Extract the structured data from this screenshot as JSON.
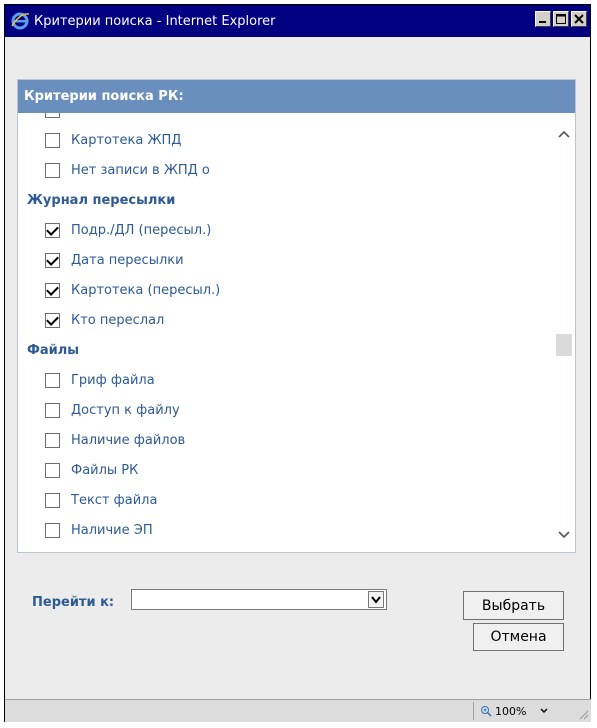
{
  "window": {
    "title": "Критерии поиска - Internet Explorer"
  },
  "panel": {
    "header": "Критерии поиска РК:",
    "items": [
      {
        "type": "checkbox",
        "label": "Картотека ЖПД",
        "checked": false
      },
      {
        "type": "checkbox",
        "label": "Нет записи в ЖПД о",
        "checked": false
      },
      {
        "type": "group",
        "label": "Журнал пересылки"
      },
      {
        "type": "checkbox",
        "label": "Подр./ДЛ (пересыл.)",
        "checked": true
      },
      {
        "type": "checkbox",
        "label": "Дата пересылки",
        "checked": true
      },
      {
        "type": "checkbox",
        "label": "Картотека (пересыл.)",
        "checked": true
      },
      {
        "type": "checkbox",
        "label": "Кто переслал",
        "checked": true
      },
      {
        "type": "group",
        "label": "Файлы"
      },
      {
        "type": "checkbox",
        "label": "Гриф файла",
        "checked": false
      },
      {
        "type": "checkbox",
        "label": "Доступ к файлу",
        "checked": false
      },
      {
        "type": "checkbox",
        "label": "Наличие файлов",
        "checked": false
      },
      {
        "type": "checkbox",
        "label": "Файлы РК",
        "checked": false
      },
      {
        "type": "checkbox",
        "label": "Текст файла",
        "checked": false
      },
      {
        "type": "checkbox",
        "label": "Наличие ЭП",
        "checked": false
      }
    ]
  },
  "goto": {
    "label": "Перейти к:",
    "value": ""
  },
  "buttons": {
    "select": "Выбрать",
    "cancel": "Отмена"
  },
  "statusbar": {
    "zoom": "100%"
  }
}
